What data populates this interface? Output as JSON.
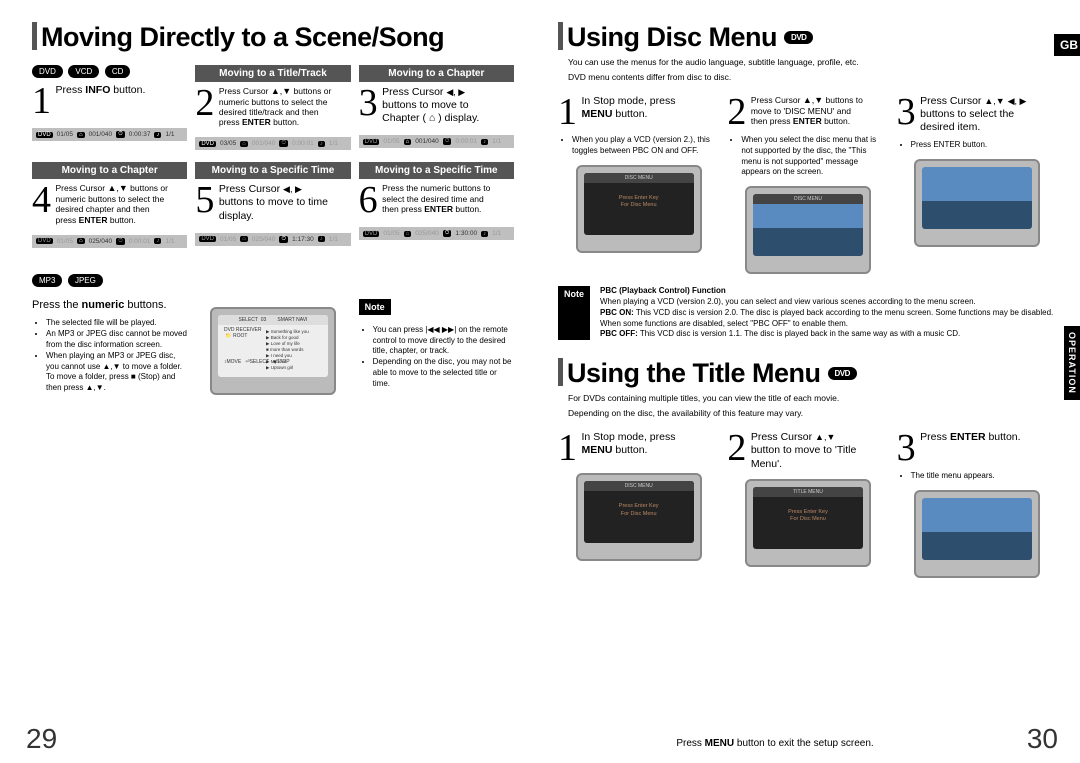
{
  "left": {
    "title": "Moving Directly to a Scene/Song",
    "badges_row1": [
      "DVD",
      "VCD",
      "CD"
    ],
    "step1": "Press INFO button.",
    "hdr_tt": "Moving to a Title/Track",
    "step2": "Press Cursor ▲,▼ buttons or numeric buttons to select the desired title/track and then press ENTER button.",
    "hdr_ch": "Moving to a Chapter",
    "step3": "Press Cursor ◀, ▶ buttons to move to Chapter ( ⌂ ) display.",
    "hdr_ch2": "Moving to a Chapter",
    "step4": "Press Cursor ▲,▼ buttons or numeric buttons to select the desired chapter and then press ENTER button.",
    "hdr_st1": "Moving to a Specific Time",
    "step5": "Press Cursor ◀, ▶ buttons to move to time display.",
    "hdr_st2": "Moving to a Specific Time",
    "step6": "Press the numeric buttons to select the desired time and then press ENTER button.",
    "strip1": {
      "a": "DVD",
      "b": "01/05",
      "c": "001/040",
      "d": "0:00:37",
      "e": "1/1"
    },
    "strip2": {
      "a": "DVD",
      "b": "03/05",
      "c": "001/040",
      "d": "0:00:01",
      "e": "1/1"
    },
    "strip3": {
      "a": "DVD",
      "b": "01/05",
      "c": "001/040",
      "d": "0:00:01",
      "e": "1/1"
    },
    "strip4": {
      "a": "DVD",
      "b": "01/05",
      "c": "025/040",
      "d": "0:00:01",
      "e": "1/1"
    },
    "strip5": {
      "a": "DVD",
      "b": "01/05",
      "c": "025/040",
      "d": "1:17:30",
      "e": "1/1"
    },
    "strip6": {
      "a": "DVD",
      "b": "01/05",
      "c": "025/040",
      "d": "1:30:00",
      "e": "1/1"
    },
    "badges_row2": [
      "MP3",
      "JPEG"
    ],
    "step_num": "Press the numeric buttons.",
    "bullets_num": [
      "The selected file will be played.",
      "An MP3 or JPEG disc cannot be moved from the disc information screen.",
      "When playing an MP3 or JPEG disc, you cannot use ▲,▼ to move a folder. To move a folder, press ■ (Stop) and then press ▲,▼."
    ],
    "note_label": "Note",
    "note_pts": [
      "You can press |◀◀ ▶▶| on the remote control to move directly to the desired title, chapter, or track.",
      "Depending on the disc, you may not be able to move to the selected title or time."
    ],
    "page": "29"
  },
  "right": {
    "gb": "GB",
    "sideop": "OPERATION",
    "disc": {
      "title": "Using Disc Menu",
      "badge": "DVD",
      "sub1": "You can use the menus for the audio language, subtitle language, profile, etc.",
      "sub2": "DVD menu contents differ from disc to disc.",
      "s1": "In Stop mode, press MENU button.",
      "s2": "Press Cursor ▲,▼ buttons to move to 'DISC MENU' and then press ENTER button.",
      "s3": "Press Cursor ▲,▼ ◀, ▶ buttons to select the desired item.",
      "b1": "When you play a VCD (version 2.), this toggles between PBC ON and OFF.",
      "b2": "When you select the disc menu that is not supported by the disc, the \"This menu is not supported\" message appears on the screen.",
      "b3": "Press ENTER button.",
      "tv_label": "DISC MENU",
      "tv_line1": "Press Enter Key",
      "tv_line2": "For Disc Menu",
      "note_label": "Note",
      "note_hdr": "PBC (Playback Control) Function",
      "note_l1": "When playing a VCD (version 2.0), you can select and view various scenes according to the menu screen.",
      "note_on": "PBC ON: This VCD disc is version 2.0. The disc is played back according to the menu screen. Some functions may be disabled. When some functions are disabled, select \"PBC OFF\" to enable them.",
      "note_off": "PBC OFF: This VCD disc is version 1.1. The disc is played back in the same way as with a music CD."
    },
    "titlem": {
      "title": "Using the Title Menu",
      "badge": "DVD",
      "sub1": "For DVDs containing multiple titles, you can view the title of each movie.",
      "sub2": "Depending on the disc, the availability of this feature may vary.",
      "s1": "In Stop mode, press MENU button.",
      "s2": "Press Cursor ▲,▼ button to move to 'Title Menu'.",
      "s3": "Press ENTER button.",
      "b3": "The title menu appears.",
      "tv_label_a": "DISC MENU",
      "tv_line_a1": "Press Enter Key",
      "tv_line_a2": "For Disc Menu",
      "tv_label_b": "TITLE MENU"
    },
    "footer": "Press MENU button to exit the setup screen.",
    "page": "30"
  }
}
